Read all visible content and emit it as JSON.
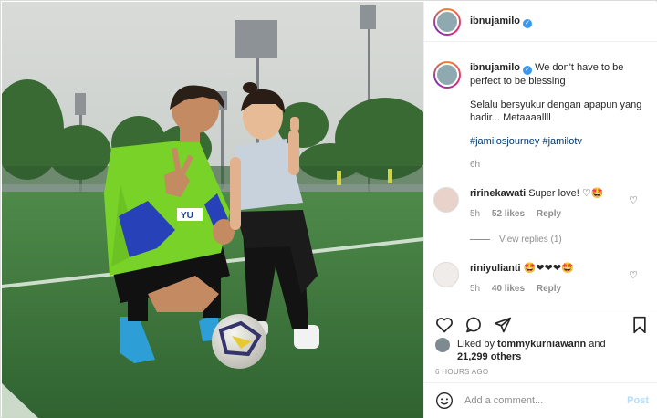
{
  "post": {
    "username": "ibnujamilo",
    "verified_mark": "✓"
  },
  "caption": {
    "username": "ibnujamilo",
    "first_line": "We don't have to be perfect to be blessing",
    "paragraph": "Selalu bersyukur dengan apapun yang hadir... Metaaaallll",
    "hashtags": "#jamilosjourney #jamilotv",
    "time": "6h"
  },
  "comments": [
    {
      "username": "ririnekawati",
      "text": "Super love!",
      "emojis": "♡🤩",
      "time": "5h",
      "likes": "52 likes",
      "reply": "Reply",
      "icon": "heart-outline-icon"
    },
    {
      "username": "riniyulianti",
      "text": "",
      "emojis": "🤩❤❤❤🤩",
      "time": "5h",
      "likes": "40 likes",
      "reply": "Reply",
      "icon": "heart-outline-icon"
    }
  ],
  "view_replies": "View replies (1)",
  "actions": {
    "liked_by_prefix": "Liked by",
    "liked_by_user": "tommykurniawann",
    "liked_by_and": "and",
    "liked_by_others": "21,299 others",
    "posted_ago": "6 HOURS AGO"
  },
  "add_comment": {
    "placeholder": "Add a comment...",
    "post_label": "Post"
  },
  "photo": {
    "jersey_text": "YU"
  },
  "colors": {
    "verified": "#3897f0",
    "hashtag": "#00376b",
    "post_disabled": "#b2dffc",
    "grass": "#3f7a3c",
    "sky": "#d4d8d6"
  }
}
